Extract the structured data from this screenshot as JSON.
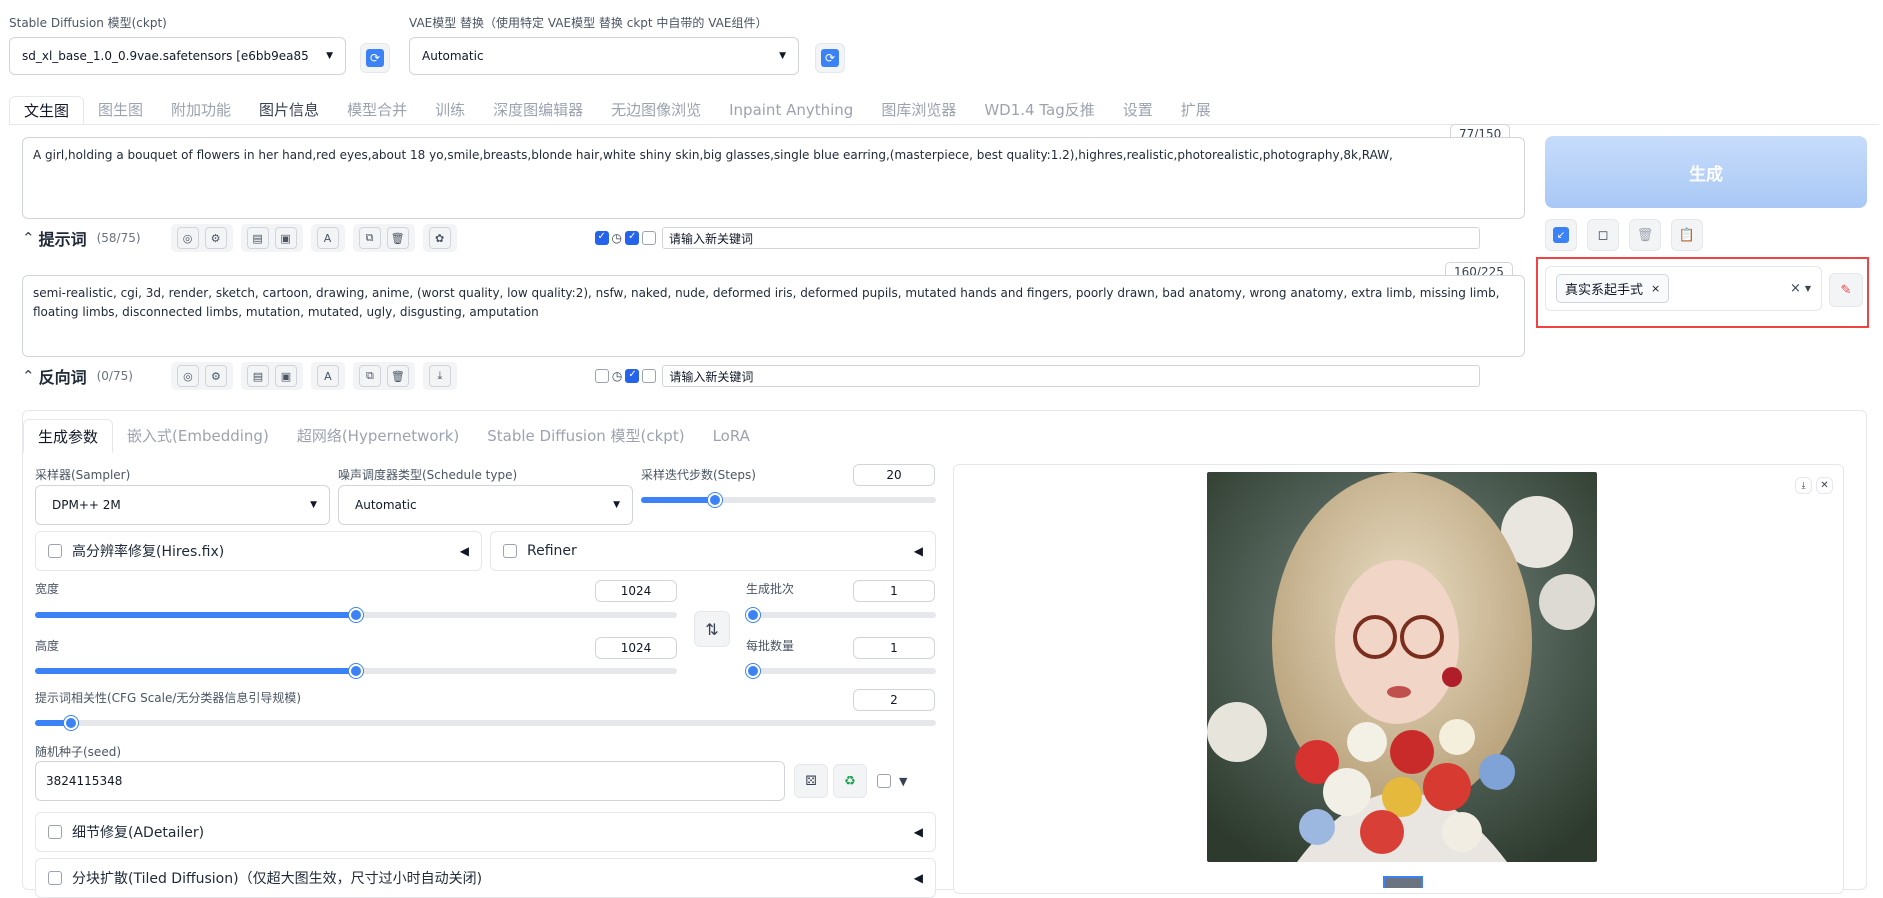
{
  "top": {
    "model_label": "Stable Diffusion 模型(ckpt)",
    "model_value": "sd_xl_base_1.0_0.9vae.safetensors [e6bb9ea85",
    "vae_label": "VAE模型 替换（使用特定 VAE模型 替换 ckpt 中自带的 VAE组件）",
    "vae_value": "Automatic"
  },
  "main_tabs": [
    "文生图",
    "图生图",
    "附加功能",
    "图片信息",
    "模型合并",
    "训练",
    "深度图编辑器",
    "无边图像浏览",
    "Inpaint Anything",
    "图库浏览器",
    "WD1.4 Tag反推",
    "设置",
    "扩展"
  ],
  "prompt": {
    "counter": "77/150",
    "text": "A girl,holding a bouquet of flowers in her hand,red eyes,about 18 yo,smile,breasts,blonde hair,white shiny skin,big glasses,single blue earring,(masterpiece, best quality:1.2),highres,realistic,photorealistic,photography,8k,RAW,",
    "label": "提示词",
    "sub_count": "(58/75)",
    "keyword_placeholder": "请输入新关键词"
  },
  "negative": {
    "counter": "160/225",
    "text": "semi-realistic, cgi, 3d, render, sketch, cartoon, drawing, anime, (worst quality, low quality:2), nsfw, naked, nude, deformed iris, deformed pupils, mutated hands and fingers, poorly drawn, bad anatomy, wrong anatomy, extra limb, missing limb, floating limbs, disconnected limbs, mutation, mutated, ugly, disgusting, amputation",
    "label": "反向词",
    "sub_count": "(0/75)",
    "keyword_placeholder": "请输入新关键词"
  },
  "generate": {
    "label": "生成",
    "style_tag": "真实系起手式",
    "tag_remove": "×",
    "clear": "×"
  },
  "sub_tabs": [
    "生成参数",
    "嵌入式(Embedding)",
    "超网络(Hypernetwork)",
    "Stable Diffusion 模型(ckpt)",
    "LoRA"
  ],
  "params": {
    "sampler_label": "采样器(Sampler)",
    "sampler_value": "DPM++ 2M",
    "schedule_label": "噪声调度器类型(Schedule type)",
    "schedule_value": "Automatic",
    "steps_label": "采样迭代步数(Steps)",
    "steps_value": "20",
    "steps_fraction": 0.25,
    "hires_label": "高分辨率修复(Hires.fix)",
    "refiner_label": "Refiner",
    "width_label": "宽度",
    "width_value": "1024",
    "width_fraction": 0.5,
    "height_label": "高度",
    "height_value": "1024",
    "height_fraction": 0.5,
    "batch_count_label": "生成批次",
    "batch_count_value": "1",
    "batch_size_label": "每批数量",
    "batch_size_value": "1",
    "cfg_label": "提示词相关性(CFG Scale/无分类器信息引导规模)",
    "cfg_value": "2",
    "cfg_fraction": 0.04,
    "seed_label": "随机种子(seed)",
    "seed_value": "3824115348",
    "adetailer_label": "细节修复(ADetailer)",
    "tiled_label": "分块扩散(Tiled Diffusion)（仅超大图生效，尺寸过小时自动关闭)"
  },
  "colors": {
    "accent": "#3b82f6",
    "generate_bg": "#bfdbfe",
    "highlight_red": "#ef4444"
  }
}
